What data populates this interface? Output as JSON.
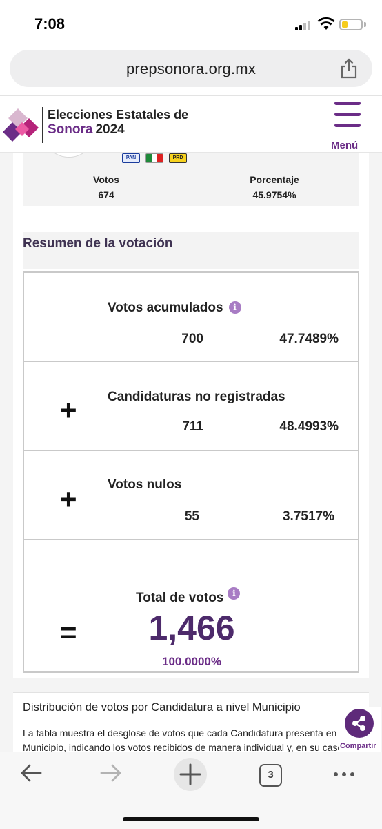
{
  "status_bar": {
    "time": "7:08"
  },
  "browser": {
    "url": "prepsonora.org.mx",
    "share_icon": "share-icon",
    "toolbar": {
      "tabs_count": "3"
    }
  },
  "site_header": {
    "brand_line1": "Elecciones Estatales de",
    "brand_accent": "Sonora",
    "brand_year": "2024",
    "menu_label": "Menú",
    "accent_color": "#6b2d87"
  },
  "candidate": {
    "party_logos": [
      "PAN",
      "PRI",
      "PRD"
    ],
    "votes_label": "Votos",
    "votes_value": "674",
    "pct_label": "Porcentaje",
    "pct_value": "45.9754%"
  },
  "resumen": {
    "title": "Resumen de la votación",
    "rows": [
      {
        "operator": "",
        "label": "Votos acumulados",
        "info": "i",
        "votes": "700",
        "pct": "47.7489%"
      },
      {
        "operator": "+",
        "label": "Candidaturas no registradas",
        "votes": "711",
        "pct": "48.4993%"
      },
      {
        "operator": "+",
        "label": "Votos nulos",
        "votes": "55",
        "pct": "3.7517%"
      }
    ],
    "total": {
      "operator": "=",
      "label": "Total de votos",
      "info": "i",
      "value": "1,466",
      "pct": "100.0000%"
    }
  },
  "distribucion": {
    "title": "Distribución de votos por Candidatura a nivel Municipio",
    "description": "La tabla muestra el desglose de votos que cada Candidatura presenta en el Municipio, indicando los votos recibidos de manera individual y, en su caso, lo"
  },
  "share_fab": {
    "label": "Compartir"
  }
}
